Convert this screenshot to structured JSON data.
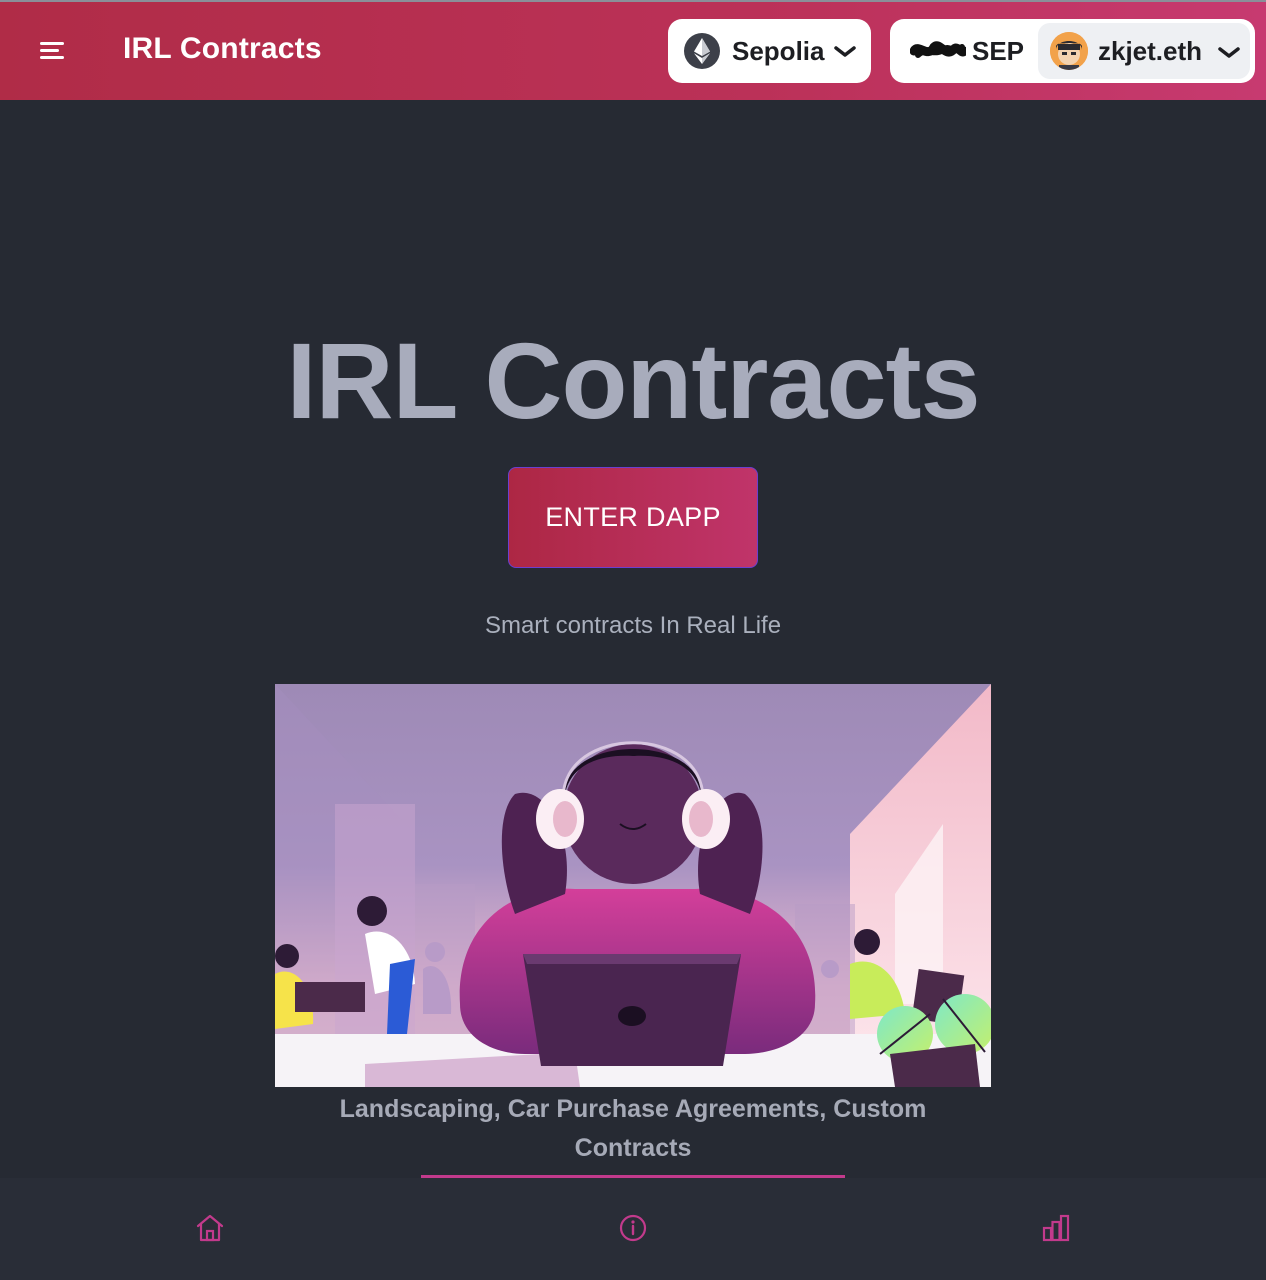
{
  "header": {
    "app_title": "IRL Contracts",
    "network": {
      "label": "Sepolia",
      "icon": "ethereum-icon"
    },
    "balance": {
      "currency": "SEP"
    },
    "account": {
      "label": "zkjet.eth",
      "icon": "avatar"
    }
  },
  "hero": {
    "title": "IRL Contracts",
    "enter_button": "ENTER DAPP",
    "tagline": "Smart contracts In Real Life",
    "illustration": "person-with-headphones-at-laptop-illustration",
    "caption": "Landscaping, Car Purchase Agreements, Custom Contracts"
  },
  "bottom_nav": {
    "items": [
      {
        "icon": "home-icon"
      },
      {
        "icon": "info-icon"
      },
      {
        "icon": "bar-chart-icon"
      }
    ]
  },
  "colors": {
    "header_start": "#b02c47",
    "header_end": "#c73a70",
    "background": "#262a33",
    "accent": "#c23a8c",
    "title_text": "#a8acbc"
  }
}
